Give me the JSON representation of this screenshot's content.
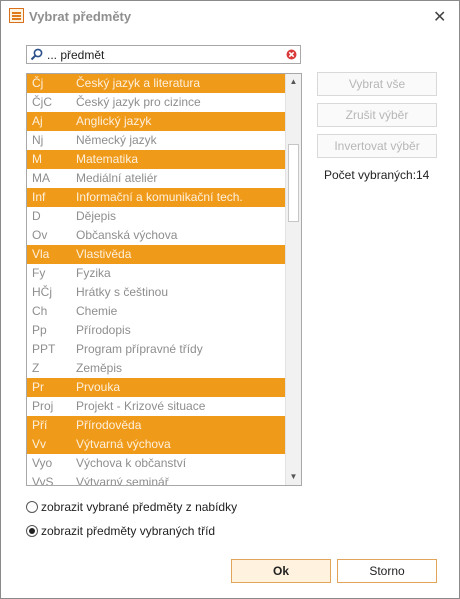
{
  "window": {
    "title": "Vybrat předměty",
    "close_icon": "close-icon"
  },
  "search": {
    "value": "... předmět",
    "icon": "search-icon",
    "clear_icon": "clear-icon"
  },
  "list": {
    "items": [
      {
        "code": "Čj",
        "name": "Český jazyk a literatura",
        "selected": true
      },
      {
        "code": "ČjC",
        "name": "Český jazyk pro cizince",
        "selected": false
      },
      {
        "code": "Aj",
        "name": "Anglický jazyk",
        "selected": true
      },
      {
        "code": "Nj",
        "name": "Německý jazyk",
        "selected": false
      },
      {
        "code": "M",
        "name": "Matematika",
        "selected": true
      },
      {
        "code": "MA",
        "name": "Mediální ateliér",
        "selected": false
      },
      {
        "code": "Inf",
        "name": "Informační a komunikační tech.",
        "selected": true
      },
      {
        "code": "D",
        "name": "Dějepis",
        "selected": false
      },
      {
        "code": "Ov",
        "name": "Občanská výchova",
        "selected": false
      },
      {
        "code": "Vla",
        "name": "Vlastivěda",
        "selected": true
      },
      {
        "code": "Fy",
        "name": "Fyzika",
        "selected": false
      },
      {
        "code": "HČj",
        "name": "Hrátky s češtinou",
        "selected": false
      },
      {
        "code": "Ch",
        "name": "Chemie",
        "selected": false
      },
      {
        "code": "Pp",
        "name": "Přírodopis",
        "selected": false
      },
      {
        "code": "PPT",
        "name": "Program přípravné třídy",
        "selected": false
      },
      {
        "code": "Z",
        "name": "Zeměpis",
        "selected": false
      },
      {
        "code": "Pr",
        "name": "Prvouka",
        "selected": true
      },
      {
        "code": "Proj",
        "name": "Projekt - Krizové situace",
        "selected": false
      },
      {
        "code": "Pří",
        "name": "Přírodověda",
        "selected": true
      },
      {
        "code": "Vv",
        "name": "Výtvarná výchova",
        "selected": true
      },
      {
        "code": "Vyo",
        "name": "Výchova k občanství",
        "selected": false
      },
      {
        "code": "VyS",
        "name": "Výtvarný seminář",
        "selected": false
      }
    ]
  },
  "actions": {
    "select_all": "Vybrat vše",
    "deselect": "Zrušit výběr",
    "invert": "Invertovat výběr",
    "count_label": "Počet vybraných:",
    "count_value": "14"
  },
  "radios": [
    {
      "label": "zobrazit vybrané předměty z nabídky",
      "checked": false
    },
    {
      "label": "zobrazit předměty vybraných tříd",
      "checked": true
    }
  ],
  "footer": {
    "ok": "Ok",
    "cancel": "Storno"
  }
}
